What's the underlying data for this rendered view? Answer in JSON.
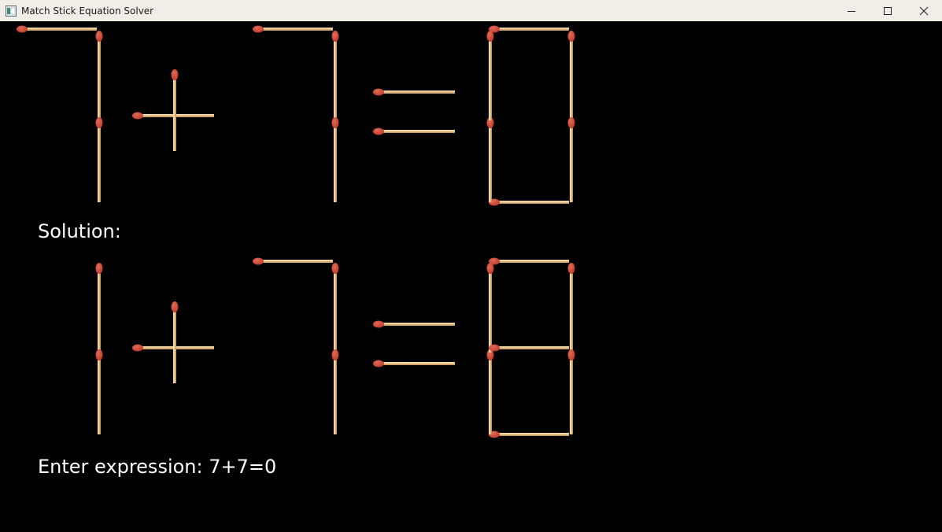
{
  "window": {
    "title": "Match Stick Equation Solver",
    "app_icon": "app-window-icon",
    "controls": [
      "minimize-icon",
      "maximize-icon",
      "close-icon"
    ]
  },
  "puzzle": {
    "equation": "7+7=0",
    "symbols": [
      "7",
      "+",
      "7",
      "=",
      "0"
    ]
  },
  "solution": {
    "label": "Solution:",
    "equation": "1+7=8",
    "symbols": [
      "1",
      "+",
      "7",
      "=",
      "8"
    ]
  },
  "input": {
    "prompt": "Enter expression: ",
    "value": "7+7=0",
    "line": "Enter expression: 7+7=0"
  },
  "colors": {
    "background": "#000000",
    "stick_wood": "#e8c48c",
    "match_head": "#c0392b",
    "text": "#ffffff"
  }
}
